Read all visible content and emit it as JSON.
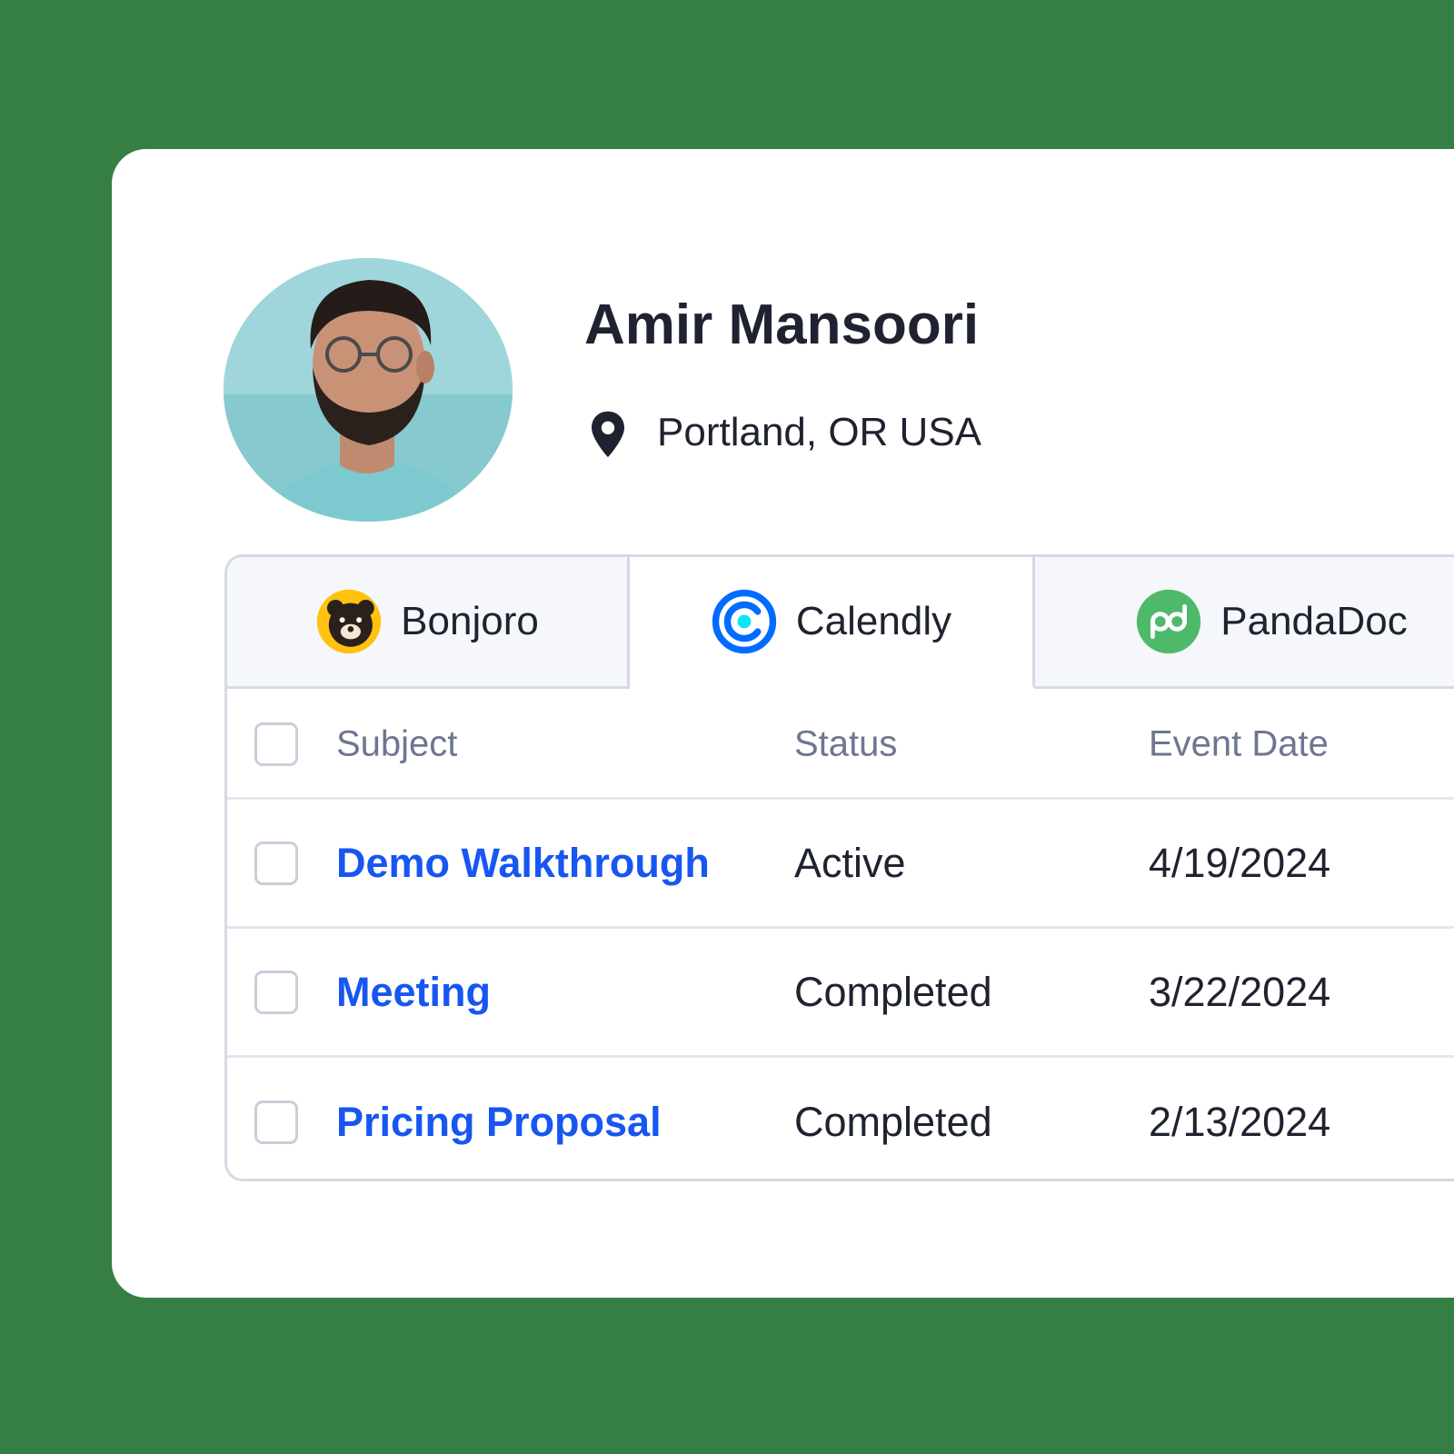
{
  "profile": {
    "name": "Amir Mansoori",
    "location": "Portland, OR USA"
  },
  "tabs": [
    {
      "label": "Bonjoro",
      "icon": "bonjoro-bear-icon",
      "active": false
    },
    {
      "label": "Calendly",
      "icon": "calendly-icon",
      "active": true
    },
    {
      "label": "PandaDoc",
      "icon": "pandadoc-icon",
      "active": false
    }
  ],
  "table": {
    "columns": [
      "Subject",
      "Status",
      "Event Date"
    ],
    "rows": [
      {
        "subject": "Demo Walkthrough",
        "status": "Active",
        "date": "4/19/2024"
      },
      {
        "subject": "Meeting",
        "status": "Completed",
        "date": "3/22/2024"
      },
      {
        "subject": "Pricing Proposal",
        "status": "Completed",
        "date": "2/13/2024"
      }
    ]
  },
  "colors": {
    "background": "#357e44",
    "card": "#ffffff",
    "link": "#1756f0",
    "bonjoro": "#ffc20e",
    "calendly": "#006bff",
    "pandadoc": "#4fb96a"
  }
}
